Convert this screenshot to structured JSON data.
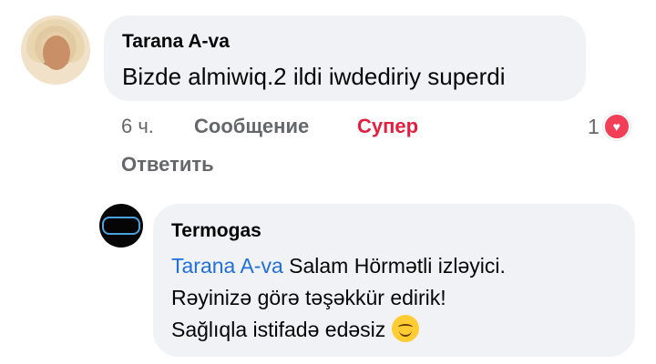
{
  "comment": {
    "author": "Tarana A-va",
    "text": "Bizde almiwiq.2 ildi iwdediriy superdi",
    "time": "6 ч.",
    "message_label": "Сообщение",
    "reaction_label": "Супер",
    "reply_label": "Ответить",
    "reaction_count": "1",
    "reaction_icon": "heart-icon"
  },
  "reply": {
    "author": "Termogas",
    "mention": "Tarana A-va",
    "line1_rest": " Salam Hörmətli izləyici.",
    "line2": "Rəyinizə görə təşəkkür edirik!",
    "line3": "Sağlıqla istifadə edəsiz ",
    "emoji": "smiling-face-icon"
  },
  "colors": {
    "bubble": "#f0f2f5",
    "link": "#216fdb",
    "super": "#e41e3f",
    "meta": "#65676b",
    "heart": "#f33e58"
  }
}
